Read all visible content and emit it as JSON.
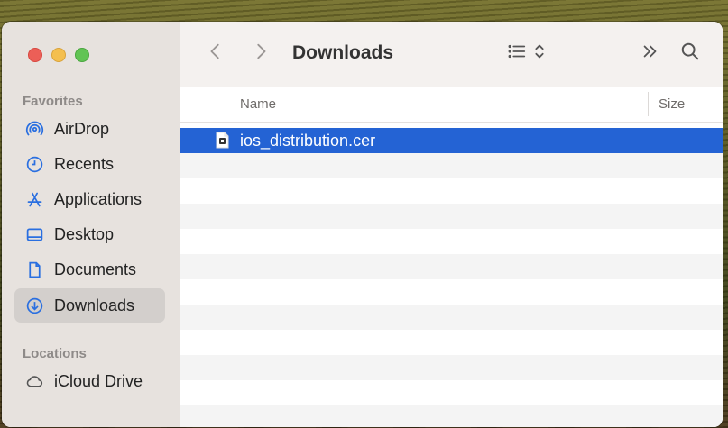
{
  "window": {
    "title": "Downloads"
  },
  "sidebar": {
    "favorites_title": "Favorites",
    "items": [
      {
        "label": "AirDrop",
        "icon": "airdrop-icon"
      },
      {
        "label": "Recents",
        "icon": "clock-icon"
      },
      {
        "label": "Applications",
        "icon": "applications-icon"
      },
      {
        "label": "Desktop",
        "icon": "desktop-icon"
      },
      {
        "label": "Documents",
        "icon": "document-icon"
      },
      {
        "label": "Downloads",
        "icon": "download-icon",
        "selected": true
      }
    ],
    "locations_title": "Locations",
    "locations": [
      {
        "label": "iCloud Drive",
        "icon": "cloud-icon"
      }
    ]
  },
  "columns": {
    "name": "Name",
    "size": "Size"
  },
  "files": [
    {
      "name": "ios_distribution.cer",
      "icon": "certificate-file-icon",
      "selected": true
    }
  ],
  "colors": {
    "accent": "#2463d4",
    "sidebar_icon": "#2a6fe0"
  }
}
